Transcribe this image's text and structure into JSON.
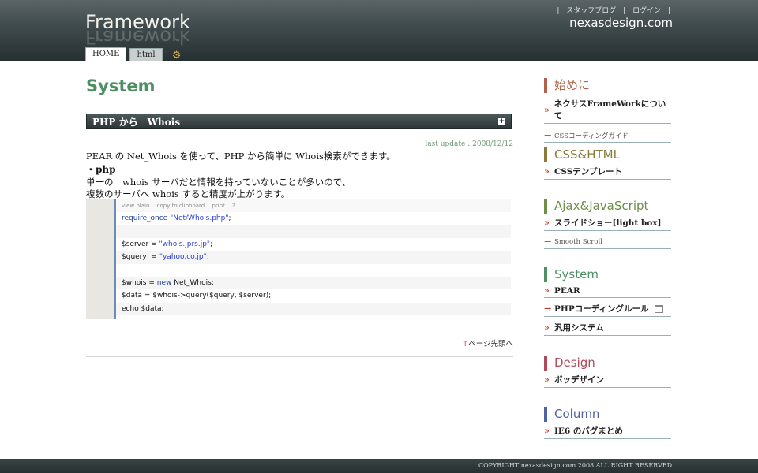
{
  "header": {
    "logo": "Framework",
    "top_links": [
      "スタッフブログ",
      "ログイン"
    ],
    "site_name": "nexasdesign.com",
    "tabs": [
      "HOME",
      "html"
    ]
  },
  "main": {
    "title": "System",
    "section_title": "PHP から　Whois",
    "last_update": "last update : 2008/12/12",
    "intro": "PEAR の Net_Whois を使って、PHP から簡単に Whois検索ができます。",
    "php_heading": "・php",
    "desc_line1": "単一の　whois サーバだと情報を持っていないことが多いので、",
    "desc_line2": "複数のサーバへ whois すると精度が上がります。",
    "code_tools": [
      "view plain",
      "copy to clipboard",
      "print",
      "?"
    ],
    "code": {
      "l1_kw": "require_once",
      "l1_str": "\"Net/Whois.php\"",
      "l1_end": ";",
      "l3": "$server = ",
      "l3_str": "\"whois.jprs.jp\"",
      "l3_end": ";",
      "l4": "$query  = ",
      "l4_str": "\"yahoo.co.jp\"",
      "l4_end": ";",
      "l6": "$whois = ",
      "l6_kw": "new",
      "l6_end": " Net_Whois;",
      "l7": "$data = $whois->query($query, $server);",
      "l8": "echo $data;"
    },
    "page_top": "ページ先頭へ"
  },
  "sidebar": {
    "sections": [
      {
        "title": "始めに",
        "color": "#b0634a",
        "items": [
          "ネクサスFrameWorkについて",
          "CSSコーディングガイド"
        ]
      },
      {
        "title": "CSS&HTML",
        "color": "#8c7a3c",
        "items": [
          "CSSテンプレート"
        ]
      },
      {
        "title": "Ajax&JavaScript",
        "color": "#6d8f48",
        "items": [
          "スライドショー[light box]",
          "Smooth Scroll"
        ]
      },
      {
        "title": "System",
        "color": "#4e8f64",
        "items": [
          "PEAR",
          "PHPコーディングルール",
          "汎用システム"
        ]
      },
      {
        "title": "Design",
        "color": "#b04a5a",
        "items": [
          "ボッデザイン"
        ]
      },
      {
        "title": "Column",
        "color": "#4f62a4",
        "items": [
          "IE6 のバグまとめ"
        ]
      }
    ]
  },
  "footer": {
    "copyright": "COPYRIGHT nexasdesign.com 2008 ALL RIGHT RESERVED"
  }
}
